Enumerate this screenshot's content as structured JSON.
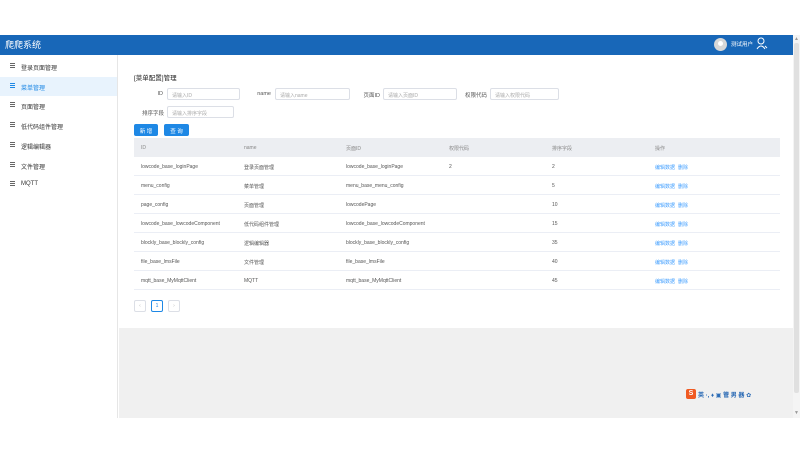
{
  "app": {
    "title": "爬爬系统",
    "username": "测试用户"
  },
  "sidebar": {
    "items": [
      {
        "label": "登录页面管理"
      },
      {
        "label": "菜单管理"
      },
      {
        "label": "页面管理"
      },
      {
        "label": "低代码组件管理"
      },
      {
        "label": "逻辑编辑器"
      },
      {
        "label": "文件管理"
      },
      {
        "label": "MQTT"
      }
    ]
  },
  "page": {
    "title": "[菜单配置]管理"
  },
  "filters": {
    "id": {
      "label": "ID",
      "placeholder": "请输入ID"
    },
    "name": {
      "label": "name",
      "placeholder": "请输入name"
    },
    "page_id": {
      "label": "页面ID",
      "placeholder": "请输入页面ID"
    },
    "perm": {
      "label": "权限代码",
      "placeholder": "请输入权限代码"
    },
    "sort": {
      "label": "排序字段",
      "placeholder": "请输入排序字段"
    }
  },
  "buttons": {
    "add": "新 增",
    "query": "查 询"
  },
  "table": {
    "headers": [
      "ID",
      "name",
      "页面ID",
      "权限代码",
      "排序字段",
      "操作"
    ],
    "rows": [
      {
        "id": "lowcode_base_loginPage",
        "name": "登录页面管理",
        "page_id": "lowcode_base_loginPage",
        "perm": "2",
        "sort": "2"
      },
      {
        "id": "menu_config",
        "name": "菜单管理",
        "page_id": "menu_base_menu_config",
        "perm": "",
        "sort": "5"
      },
      {
        "id": "page_config",
        "name": "页面管理",
        "page_id": "lowcodePage",
        "perm": "",
        "sort": "10"
      },
      {
        "id": "lowcode_base_lowcodeComponent",
        "name": "低代码组件管理",
        "page_id": "lowcode_base_lowcodeComponent",
        "perm": "",
        "sort": "15"
      },
      {
        "id": "blockly_base_blockly_config",
        "name": "逻辑编辑器",
        "page_id": "blockly_base_blockly_config",
        "perm": "",
        "sort": "35"
      },
      {
        "id": "file_base_lmsFile",
        "name": "文件管理",
        "page_id": "file_base_lmsFile",
        "perm": "",
        "sort": "40"
      },
      {
        "id": "mqtt_base_MyMqttClient",
        "name": "MQTT",
        "page_id": "mqtt_base_MyMqttClient",
        "perm": "",
        "sort": "45"
      }
    ],
    "edit_label": "编辑数据",
    "delete_label": "删除"
  },
  "pagination": {
    "prev": "‹",
    "current": "1",
    "next": "›"
  },
  "ime": {
    "logo": "S",
    "glyphs": "英 ·, ♦ ▣ 管 男 器 ✿"
  },
  "colors": {
    "topbar": "#1867b8",
    "accent": "#1e88e5",
    "link": "#409eff"
  }
}
